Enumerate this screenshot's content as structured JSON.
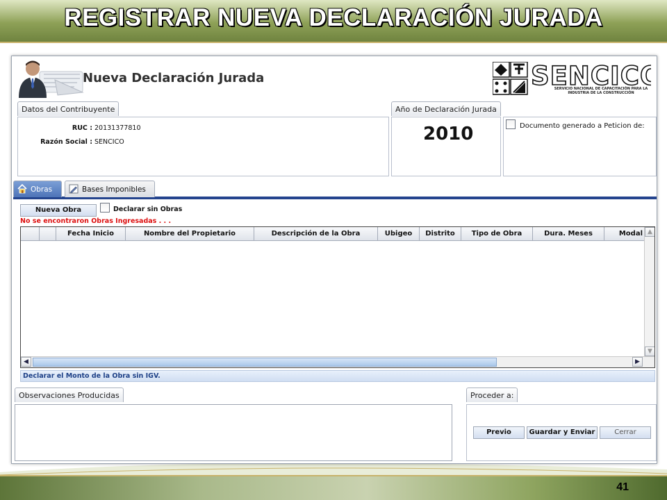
{
  "slide": {
    "title": "REGISTRAR NUEVA DECLARACIÓN JURADA",
    "page_number": "41"
  },
  "app": {
    "title": "Nueva Declaración Jurada",
    "logo_text": "SENCICO",
    "logo_tagline": "SERVICIO NACIONAL DE CAPACITACIÓN PARA LA INDUSTRIA DE LA CONSTRUCCIÓN"
  },
  "taxpayer": {
    "group_label": "Datos del Contribuyente",
    "ruc_label": "RUC :",
    "ruc_value": "20131377810",
    "name_label": "Razón Social :",
    "name_value": "SENCICO"
  },
  "declaration_year": {
    "group_label": "Año de Declaración Jurada",
    "value": "2010"
  },
  "petition": {
    "label": "Documento generado a Peticion de:",
    "checked": false
  },
  "tabs": [
    {
      "label": "Obras",
      "icon": "home-icon",
      "active": true
    },
    {
      "label": "Bases Imponibles",
      "icon": "pencil-icon",
      "active": false
    }
  ],
  "works": {
    "new_button": "Nueva Obra",
    "no_works_label": "Declarar sin Obras",
    "no_works_checked": false,
    "warning": "No se encontraron Obras Ingresadas . . .",
    "columns": [
      "",
      "",
      "Fecha Inicio",
      "Nombre del Propietario",
      "Descripción de la Obra",
      "Ubigeo",
      "Distrito",
      "Tipo de Obra",
      "Dura. Meses",
      "Modal"
    ],
    "rows": [],
    "footer_note": "Declarar el Monto de la Obra sin IGV."
  },
  "observations": {
    "group_label": "Observaciones Producidas",
    "value": ""
  },
  "proceed": {
    "group_label": "Proceder a:",
    "buttons": [
      "Previo",
      "Guardar y Enviar",
      "Cerrar"
    ]
  },
  "colors": {
    "tab_underline": "#24448e",
    "warning": "#dd1111",
    "info_text": "#1c3f86",
    "title_bar": "#8ea157"
  }
}
